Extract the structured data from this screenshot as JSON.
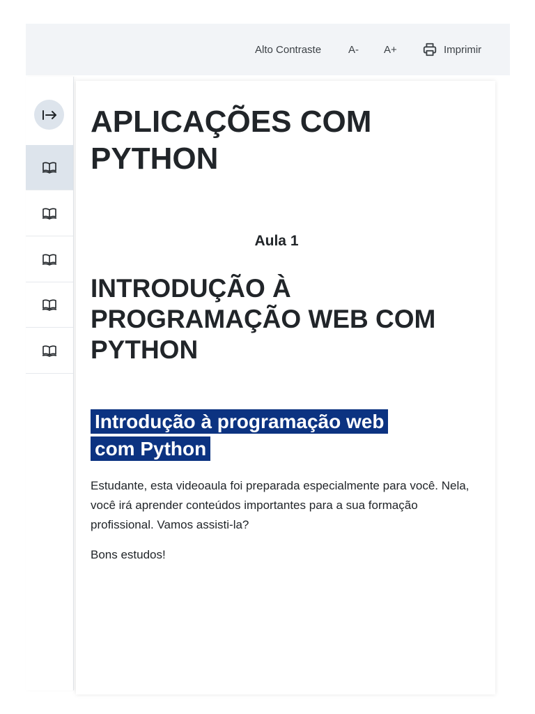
{
  "toolbar": {
    "high_contrast": "Alto Contraste",
    "font_decrease": "A-",
    "font_increase": "A+",
    "print": "Imprimir"
  },
  "sidebar": {
    "collapse_icon": "arrow-right-to-bar-icon",
    "items": [
      {
        "icon": "book-open-icon",
        "active": true
      },
      {
        "icon": "book-open-icon",
        "active": false
      },
      {
        "icon": "book-open-icon",
        "active": false
      },
      {
        "icon": "book-open-icon",
        "active": false
      },
      {
        "icon": "book-open-icon",
        "active": false
      }
    ]
  },
  "content": {
    "course_title": "APLICAÇÕES COM PYTHON",
    "lesson_label": "Aula 1",
    "lesson_title": "INTRODUÇÃO À PROGRAMAÇÃO WEB COM PYTHON",
    "section_title": "Introdução à programação web com Python",
    "intro_text": "Estudante, esta videoaula foi preparada especialmente para você. Nela, você irá aprender conteúdos importantes para a sua formação profissional. Vamos assisti-la?",
    "closing_text": "Bons estudos!"
  },
  "colors": {
    "toolbar_bg": "#f2f4f7",
    "active_nav_bg": "#dde4ec",
    "highlight_bg": "#0c3381",
    "text": "#212529"
  }
}
